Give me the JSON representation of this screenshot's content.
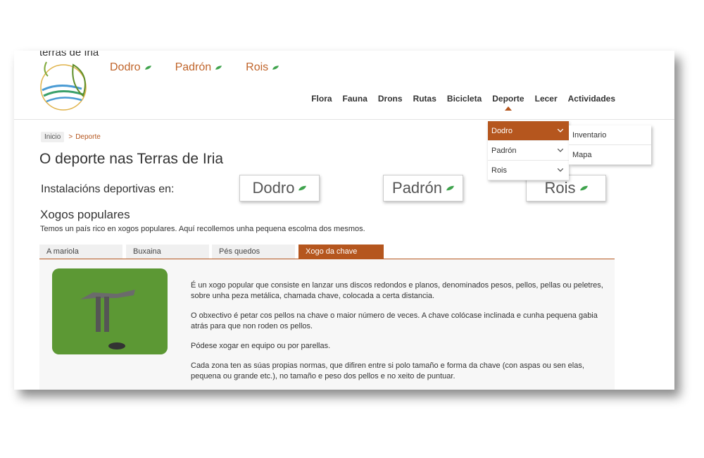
{
  "site": {
    "title": "terras de Iria"
  },
  "colors": {
    "accent": "#b5561e",
    "link": "#c0642a",
    "leaf": "#3fa34d"
  },
  "top_links": [
    {
      "label": "Dodro"
    },
    {
      "label": "Padrón"
    },
    {
      "label": "Rois"
    }
  ],
  "nav": [
    {
      "label": "Flora"
    },
    {
      "label": "Fauna"
    },
    {
      "label": "Drons"
    },
    {
      "label": "Rutas"
    },
    {
      "label": "Bicicleta"
    },
    {
      "label": "Deporte"
    },
    {
      "label": "Lecer"
    },
    {
      "label": "Actividades"
    }
  ],
  "nav_active": "Deporte",
  "breadcrumb": {
    "home": "Inicio",
    "separator": ">",
    "current": "Deporte"
  },
  "page_title": "O deporte nas Terras de Iria",
  "installations": {
    "label": "Instalacións deportivas en:",
    "buttons": [
      {
        "label": "Dodro"
      },
      {
        "label": "Padrón"
      },
      {
        "label": "Rois"
      }
    ]
  },
  "section": {
    "title": "Xogos populares",
    "description": "Temos un país rico en xogos populares. Aquí recollemos unha pequena escolma dos mesmos."
  },
  "tabs": [
    {
      "label": "A mariola"
    },
    {
      "label": "Buxaina"
    },
    {
      "label": "Pés quedos"
    },
    {
      "label": "Xogo da chave"
    }
  ],
  "active_tab": "Xogo da chave",
  "panel": {
    "paragraphs": [
      "É un xogo popular que consiste en lanzar uns discos redondos e planos, denominados pesos, pellos, pellas ou peletres, sobre unha peza metálica, chamada chave, colocada a certa distancia.",
      "O obxectivo é petar cos pellos na chave o maior número de veces. A chave colócase inclinada e cunha pequena gabia atrás para que non roden os pellos.",
      "Pódese xogar en equipo ou por parellas.",
      "Cada zona ten as súas propias normas, que difiren entre si polo tamaño e forma da chave (con aspas ou sen elas, pequena ou grande etc.), no tamaño e peso dos pellos e no xeito de puntuar."
    ]
  },
  "dropdown": {
    "items": [
      {
        "label": "Dodro"
      },
      {
        "label": "Padrón"
      },
      {
        "label": "Rois"
      }
    ],
    "active": "Dodro",
    "submenu": [
      {
        "label": "Inventario"
      },
      {
        "label": "Mapa"
      }
    ]
  }
}
